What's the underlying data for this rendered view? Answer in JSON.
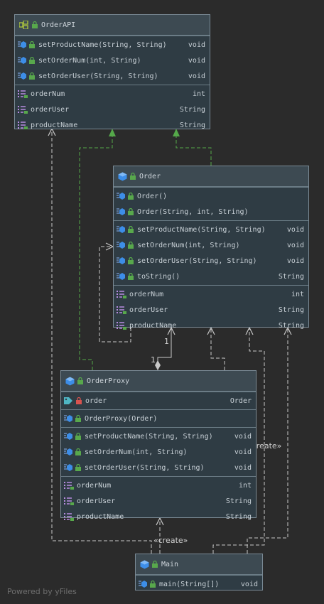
{
  "footer": "Powered by yFiles",
  "edge_labels": {
    "create_main_proxy": "«create»",
    "create_proxy_order": "«create»",
    "mult_top": "1",
    "mult_bottom": "1"
  },
  "colors": {
    "background": "#2b2b2b",
    "node_body": "#2f3c44",
    "node_header": "#3d4a52",
    "green_edge": "#55a84a",
    "dashed_edge": "#c8c8c8",
    "solid_edge": "#c8c8c8"
  },
  "nodes": {
    "orderapi": {
      "title": "OrderAPI",
      "kind": "interface",
      "methods": [
        {
          "name": "setProductName(String, String)",
          "type": "void"
        },
        {
          "name": "setOrderNum(int, String)",
          "type": "void"
        },
        {
          "name": "setOrderUser(String, String)",
          "type": "void"
        }
      ],
      "fields": [
        {
          "name": "orderNum",
          "type": "int"
        },
        {
          "name": "orderUser",
          "type": "String"
        },
        {
          "name": "productName",
          "type": "String"
        }
      ]
    },
    "order": {
      "title": "Order",
      "kind": "class",
      "constructors": [
        {
          "name": "Order()",
          "type": ""
        },
        {
          "name": "Order(String, int, String)",
          "type": ""
        }
      ],
      "methods": [
        {
          "name": "setProductName(String, String)",
          "type": "void"
        },
        {
          "name": "setOrderNum(int, String)",
          "type": "void"
        },
        {
          "name": "setOrderUser(String, String)",
          "type": "void"
        },
        {
          "name": "toString()",
          "type": "String"
        }
      ],
      "fields": [
        {
          "name": "orderNum",
          "type": "int"
        },
        {
          "name": "orderUser",
          "type": "String"
        },
        {
          "name": "productName",
          "type": "String"
        }
      ]
    },
    "orderproxy": {
      "title": "OrderProxy",
      "kind": "class",
      "private_fields": [
        {
          "name": "order",
          "type": "Order"
        }
      ],
      "constructors": [
        {
          "name": "OrderProxy(Order)",
          "type": ""
        }
      ],
      "methods": [
        {
          "name": "setProductName(String, String)",
          "type": "void"
        },
        {
          "name": "setOrderNum(int, String)",
          "type": "void"
        },
        {
          "name": "setOrderUser(String, String)",
          "type": "void"
        }
      ],
      "fields": [
        {
          "name": "orderNum",
          "type": "int"
        },
        {
          "name": "orderUser",
          "type": "String"
        },
        {
          "name": "productName",
          "type": "String"
        }
      ]
    },
    "main": {
      "title": "Main",
      "kind": "class",
      "methods": [
        {
          "name": "main(String[])",
          "type": "void"
        }
      ]
    }
  }
}
